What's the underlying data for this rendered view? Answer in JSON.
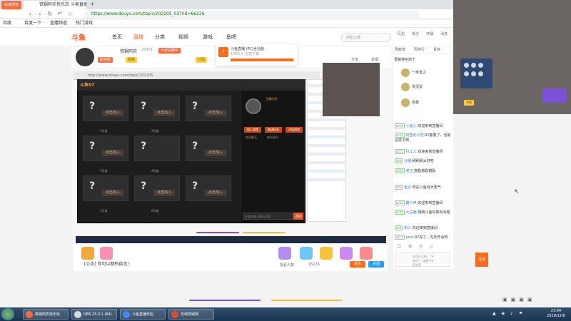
{
  "browser": {
    "app_badge": "极速浏览",
    "tabs": [
      {
        "label": "铁锅阿农快乐玩 斗鱼直播"
      }
    ],
    "new_tab": "+",
    "url": "https://www.douyu.com/topic/202205_02?rid=66226",
    "bookmarks": [
      "百度",
      "百度一下",
      "直播频道",
      "热门游戏"
    ]
  },
  "site": {
    "logo": "斗鱼",
    "nav": [
      "首页",
      "直播",
      "分类",
      "视频",
      "游戏",
      "鱼吧"
    ],
    "search_placeholder": "搜索主播",
    "header_icons": [
      "历史",
      "关注",
      "开播",
      "消息",
      "头像"
    ]
  },
  "room": {
    "host_name": "铁锅阿农",
    "viewers": "23931",
    "badges": [
      "大家在聊天",
      "分享",
      "送礼物"
    ],
    "subscribe": "订阅",
    "share": "分享",
    "report": "举报",
    "cards": [
      "粉丝团",
      "贵族"
    ]
  },
  "popup": {
    "title": "斗鱼直播 (PC)全功能",
    "subtitle": "100%+ 正在下载",
    "icon": "!"
  },
  "stream": {
    "inner_url": "http://www.douyu.com/topic/202205",
    "game_title": "斗鱼97",
    "slot_question": "?",
    "slot_button": "点击加入",
    "slot_labels": [
      "1号桌",
      "2号桌",
      "3号桌",
      "4号桌",
      "5号桌",
      "6号桌"
    ],
    "host_status": "主播在线",
    "buttons": [
      "加入游戏",
      "邀请好友",
      "开始游戏"
    ],
    "tabs": [
      "房间聊天",
      "房间成员"
    ],
    "chat_placeholder": "在此处输入聊天内容",
    "send": "发送"
  },
  "gift_bar": {
    "chat_announce": "[公告] 你可以畅所欲言！",
    "viewers_label": "观看人数",
    "count": "15173",
    "send_gift": "送礼",
    "charge": "充值"
  },
  "chat_panel": {
    "tabs": [
      "贡献榜",
      "周排行",
      "贵族"
    ],
    "rank_header": "贡献排名前十",
    "rank": [
      {
        "name": "一笑置之",
        "badge": "10级"
      },
      {
        "name": "雷蛋蛋",
        "badge": "9级"
      },
      {
        "name": "夜幕",
        "badge": "8级"
      }
    ],
    "messages": [
      {
        "lv": "LV14",
        "nick": "小鱼儿:",
        "text": "欢迎来到直播间"
      },
      {
        "lv": "LV22",
        "nick": "机智的小怪:",
        "text": "97都要了，也就这样子啊"
      },
      {
        "lv": "LV15",
        "nick": "打工人:",
        "text": "欢迎来到直播间"
      },
      {
        "lv": "LV8",
        "nick": "沙雕:",
        "text": "刷刷刷太好啦"
      },
      {
        "lv": "LV19",
        "nick": "老王:",
        "text": "鼓励鼓励鼓励"
      },
      {
        "lv": "LV6",
        "nick": "鱼丸:",
        "text": "现在斗鱼有大更气"
      },
      {
        "lv": "LV12",
        "nick": "路人甲:",
        "text": "欢迎来到直播间"
      },
      {
        "lv": "LV30",
        "nick": "大主播:",
        "text": "刚刚斗鱼好像有问题"
      },
      {
        "lv": "LV9",
        "nick": "新人:",
        "text": "欢迎来到直播间"
      },
      {
        "lv": "LV11",
        "nick": "pool:",
        "text": "97好了，先去开会吧"
      }
    ],
    "input_placeholder": "说点什么吧，“不友好”，请遵守社区规范",
    "send": "发送"
  },
  "taskbar": {
    "tasks": [
      "铁锅阿农快乐玩",
      "OBS 25.0.1 (64)",
      "斗鱼直播伴侣",
      "无线局域网"
    ],
    "time": "23:04",
    "date": "2018/12/8"
  },
  "colors": {
    "brand": "#ff5d23",
    "charge_blue": "#2d9cf4",
    "chat_level_green": "#4aa54a"
  }
}
